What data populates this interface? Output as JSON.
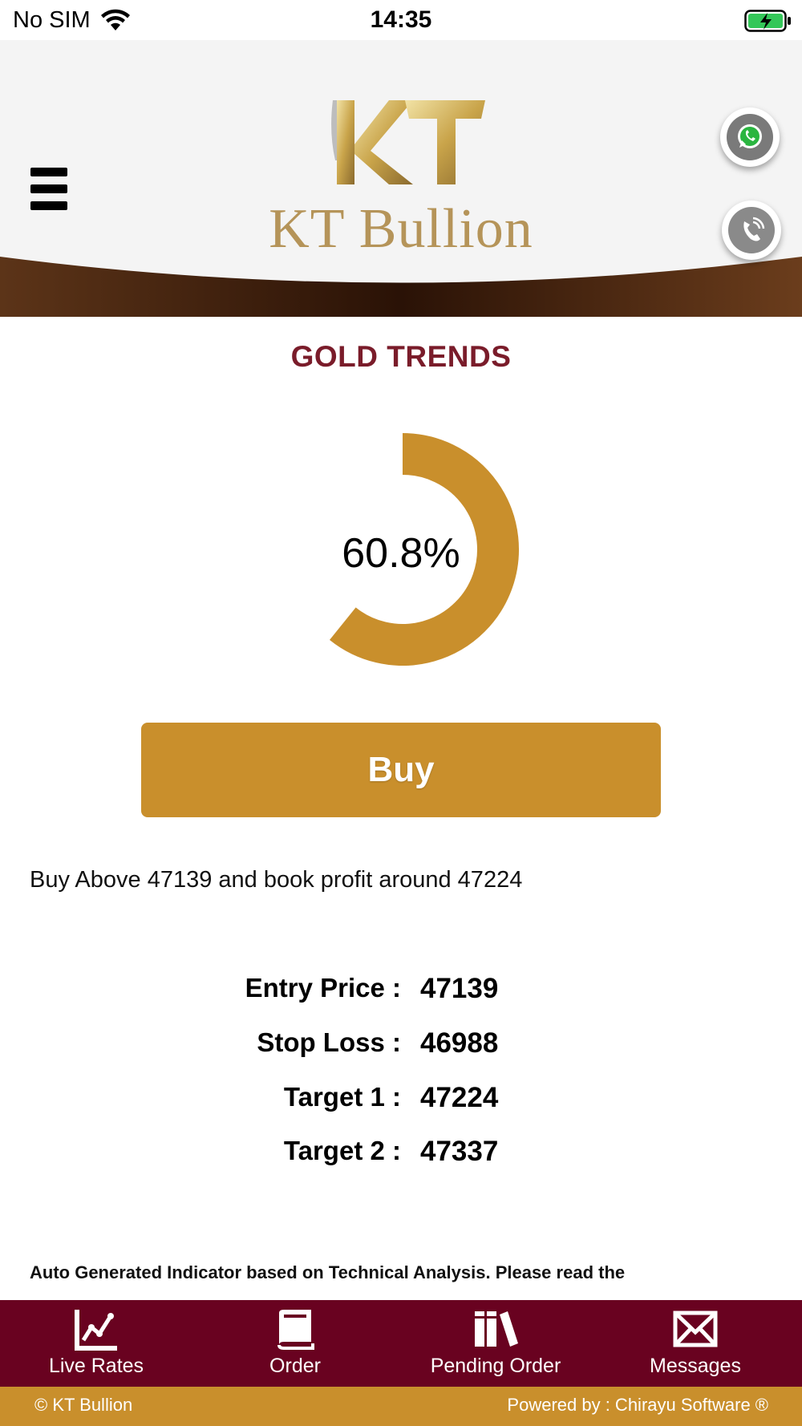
{
  "status_bar": {
    "carrier": "No SIM",
    "time": "14:35",
    "wifi_icon": "wifi-icon",
    "battery_icon": "battery-charging-icon"
  },
  "header": {
    "logo_text": "KT Bullion",
    "menu_icon": "hamburger-menu-icon",
    "whatsapp_icon": "whatsapp-icon",
    "phone_icon": "phone-icon"
  },
  "main": {
    "title": "GOLD TRENDS",
    "gauge": {
      "label": "60.8%",
      "value": 0.608,
      "color": "#c98f2c"
    },
    "buy_label": "Buy",
    "advice": "Buy Above 47139 and book profit around 47224",
    "levels": [
      {
        "label": "Entry Price :",
        "value": "47139"
      },
      {
        "label": "Stop Loss :",
        "value": "46988"
      },
      {
        "label": "Target 1 :",
        "value": "47224"
      },
      {
        "label": "Target 2 :",
        "value": "47337"
      }
    ],
    "disclaimer": "Auto Generated Indicator based on Technical Analysis. Please read the"
  },
  "bottom_nav": [
    {
      "label": "Live Rates",
      "icon": "chart-line-icon"
    },
    {
      "label": "Order",
      "icon": "book-icon"
    },
    {
      "label": "Pending Order",
      "icon": "books-icon"
    },
    {
      "label": "Messages",
      "icon": "envelope-icon"
    }
  ],
  "footer": {
    "left": "© KT Bullion",
    "right": "Powered by : Chirayu Software ®"
  },
  "colors": {
    "accent": "#c98f2c",
    "brand_dark": "#690220",
    "title": "#7a1c2a"
  }
}
